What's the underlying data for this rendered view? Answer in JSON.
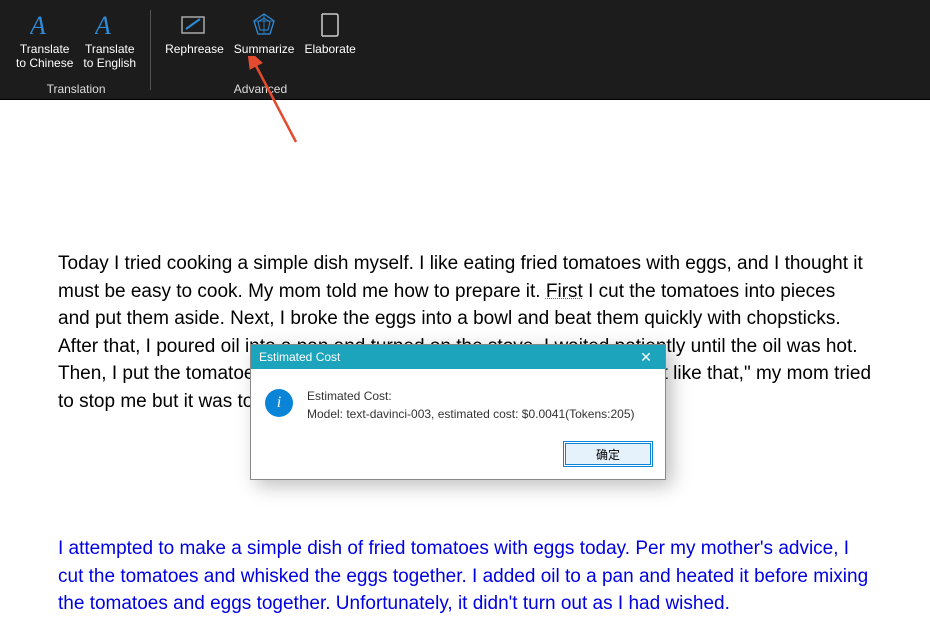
{
  "ribbon": {
    "group1": {
      "label": "Translation",
      "btn1": {
        "line1": "Translate",
        "line2": "to Chinese"
      },
      "btn2": {
        "line1": "Translate",
        "line2": "to English"
      }
    },
    "group2": {
      "label": "Advanced",
      "btn1": "Rephrease",
      "btn2": "Summarize",
      "btn3": "Elaborate"
    }
  },
  "document": {
    "paragraph1_pre": "Today I tried cooking a simple dish myself. I like eating fried tomatoes with eggs, and I thought it must be easy to cook. My mom told me how to prepare it. ",
    "paragraph1_u": "First",
    "paragraph1_post": " I cut the tomatoes into pieces and put them aside. Next, I broke the eggs into a bowl and beat them quickly with chopsticks. After that, I poured oil into a pan and turned on the stove. I waited patiently until the oil was hot. Then, I put the tomatoes and the beaten eggs into the pan together. \"Not like that,\" my mom tried to stop me but it was too late. It didn’t turn out as I had wished.",
    "paragraph2": "I attempted to make a simple dish of fried tomatoes with eggs today. Per my mother's advice, I cut the tomatoes and whisked the eggs together. I added oil to a pan and heated it before mixing the tomatoes and eggs together. Unfortunately, it didn't turn out as I had wished."
  },
  "dialog": {
    "title": "Estimated Cost",
    "line1": "Estimated Cost:",
    "line2": "Model: text-davinci-003, estimated cost: $0.0041(Tokens:205)",
    "ok": "确定"
  }
}
